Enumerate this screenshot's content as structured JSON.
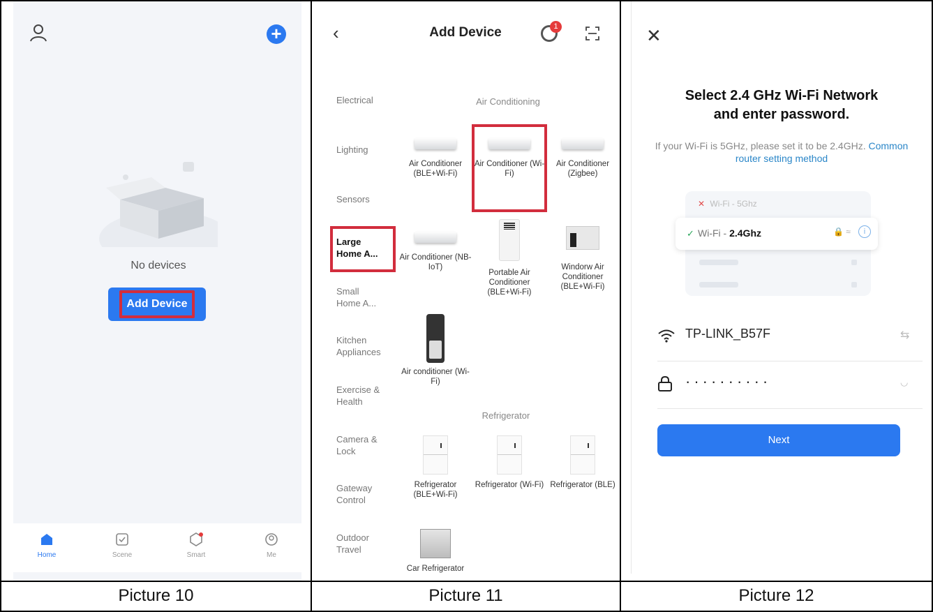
{
  "colors": {
    "accent": "#2b79f0",
    "highlight": "#d22d3d",
    "badge": "#e53b3b",
    "link": "#2a86c8"
  },
  "captions": [
    "Picture 10",
    "Picture 11",
    "Picture 12"
  ],
  "p1": {
    "empty_text": "No devices",
    "add_button": "Add Device",
    "tabs": [
      {
        "label": "Home",
        "icon": "home-icon"
      },
      {
        "label": "Scene",
        "icon": "scene-icon"
      },
      {
        "label": "Smart",
        "icon": "smart-icon"
      },
      {
        "label": "Me",
        "icon": "me-icon"
      }
    ]
  },
  "p2": {
    "title": "Add Device",
    "notification_count": "1",
    "categories": [
      "Electrical",
      "Lighting",
      "Sensors",
      "Large Home A...",
      "Small Home A...",
      "Kitchen Appliances",
      "Exercise & Health",
      "Camera & Lock",
      "Gateway Control",
      "Outdoor Travel"
    ],
    "sections": {
      "ac": "Air Conditioning",
      "fridge": "Refrigerator"
    },
    "devices": [
      {
        "name": "Air Conditioner (BLE+Wi-Fi)"
      },
      {
        "name": "Air Conditioner (Wi-Fi)"
      },
      {
        "name": "Air Conditioner (Zigbee)"
      },
      {
        "name": "Air Conditioner (NB-IoT)"
      },
      {
        "name": "Portable Air Conditioner (BLE+Wi-Fi)"
      },
      {
        "name": "Windorw Air Conditioner (BLE+Wi-Fi)"
      },
      {
        "name": "Air conditioner (Wi-Fi)"
      },
      {
        "name": "Refrigerator (BLE+Wi-Fi)"
      },
      {
        "name": "Refrigerator (Wi-Fi)"
      },
      {
        "name": "Refrigerator (BLE)"
      },
      {
        "name": "Car Refrigerator"
      }
    ]
  },
  "p3": {
    "heading_line1": "Select 2.4 GHz Wi-Fi Network",
    "heading_line2": "and enter password.",
    "sub_text": "If your Wi-Fi is 5GHz, please set it to be 2.4GHz.",
    "sub_link": "Common router setting method",
    "wifi_bad_prefix": "Wi-Fi - ",
    "wifi_bad_band": "5Ghz",
    "wifi_good_prefix": "Wi-Fi - ",
    "wifi_good_band": "2.4Ghz",
    "ssid": "TP-LINK_B57F",
    "password_mask": "··········",
    "next_button": "Next"
  }
}
